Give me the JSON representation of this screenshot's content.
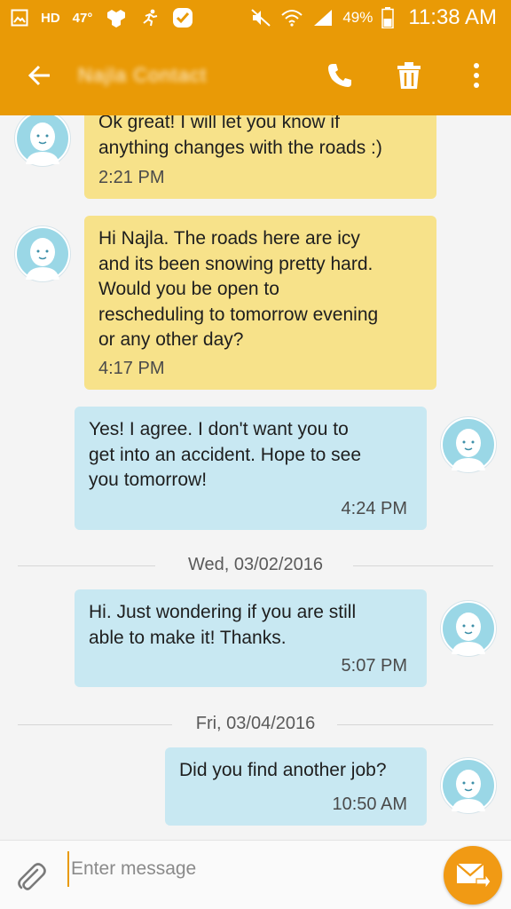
{
  "status_bar": {
    "hd": "HD",
    "temperature": "47°",
    "battery_percent": "49%",
    "time": "11:38 AM"
  },
  "app_bar": {
    "contact_name": "Najla Contact"
  },
  "conversation": {
    "messages": [
      {
        "direction": "incoming",
        "lines": [
          "Ok great! I will let you know if",
          "anything changes with the roads :)"
        ],
        "time": "2:21 PM"
      },
      {
        "direction": "incoming",
        "lines": [
          "Hi Najla. The roads here are icy",
          "and its been snowing pretty hard.",
          "Would you be open to",
          "rescheduling to tomorrow evening",
          "or any other day?"
        ],
        "time": "4:17 PM"
      },
      {
        "direction": "outgoing",
        "lines": [
          "Yes! I agree. I don't want you to",
          "get into an accident. Hope to see",
          "you tomorrow!"
        ],
        "time": "4:24 PM"
      },
      {
        "direction": "outgoing",
        "lines": [
          "Hi. Just wondering if you are still",
          "able to make it! Thanks."
        ],
        "time": "5:07 PM"
      },
      {
        "direction": "outgoing",
        "lines": [
          "Did you find another job?"
        ],
        "time": "10:50 AM"
      }
    ],
    "date_separators": [
      "Wed, 03/02/2016",
      "Fri, 03/04/2016"
    ]
  },
  "composer": {
    "placeholder": "Enter message"
  },
  "colors": {
    "app_bar": "#e99a06",
    "incoming_bubble": "#f7e28a",
    "outgoing_bubble": "#c8e8f2",
    "send_button": "#f19a14"
  },
  "icons": {
    "back": "arrow-left-icon",
    "call": "phone-icon",
    "delete": "trash-icon",
    "more": "more-vertical-icon",
    "attach": "paperclip-icon",
    "send": "send-envelope-icon"
  }
}
